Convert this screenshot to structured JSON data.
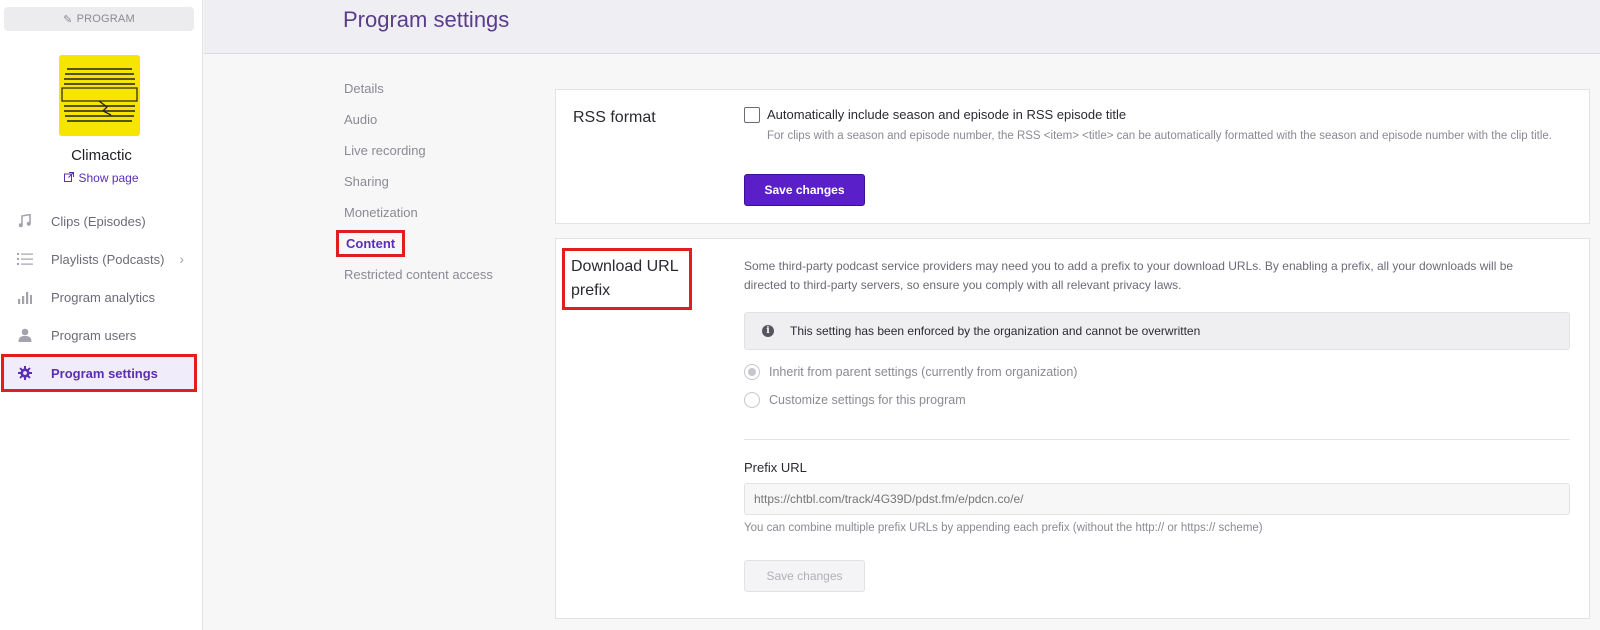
{
  "sidebar": {
    "program_chip": "PROGRAM",
    "program_name": "Climactic",
    "logo_text": "CLIMACTIC",
    "show_page": "Show page",
    "items": [
      {
        "label": "Clips (Episodes)",
        "icon": "music-note-icon"
      },
      {
        "label": "Playlists (Podcasts)",
        "icon": "list-icon"
      },
      {
        "label": "Program analytics",
        "icon": "bar-chart-icon"
      },
      {
        "label": "Program users",
        "icon": "user-icon"
      },
      {
        "label": "Program settings",
        "icon": "gear-icon"
      }
    ]
  },
  "header": {
    "title": "Program settings"
  },
  "settings_nav": {
    "items": [
      "Details",
      "Audio",
      "Live recording",
      "Sharing",
      "Monetization",
      "Content",
      "Restricted content access"
    ],
    "active": "Content"
  },
  "rss_section": {
    "title": "RSS format",
    "checkbox_label": "Automatically include season and episode in RSS episode title",
    "checkbox_checked": false,
    "help": "For clips with a season and episode number, the RSS <item> <title> can be automatically formatted with the season and episode number with the clip title.",
    "save_label": "Save changes"
  },
  "download_section": {
    "title": "Download URL prefix",
    "description": "Some third-party podcast service providers may need you to add a prefix to your download URLs. By enabling a prefix, all your downloads will be directed to third-party servers, so ensure you comply with all relevant privacy laws.",
    "notice": "This setting has been enforced by the organization and cannot be overwritten",
    "radio_inherit": "Inherit from parent settings (currently from organization)",
    "radio_customize": "Customize settings for this program",
    "selected": "inherit",
    "prefix_label": "Prefix URL",
    "prefix_placeholder": "https://chtbl.com/track/4G39D/pdst.fm/e/pdcn.co/e/",
    "prefix_help": "You can combine multiple prefix URLs by appending each prefix (without the http:// or https:// scheme)",
    "save_label": "Save changes"
  },
  "colors": {
    "accent": "#5b1fc9",
    "highlight": "#e21d1d",
    "logo_bg": "#f5e500"
  }
}
